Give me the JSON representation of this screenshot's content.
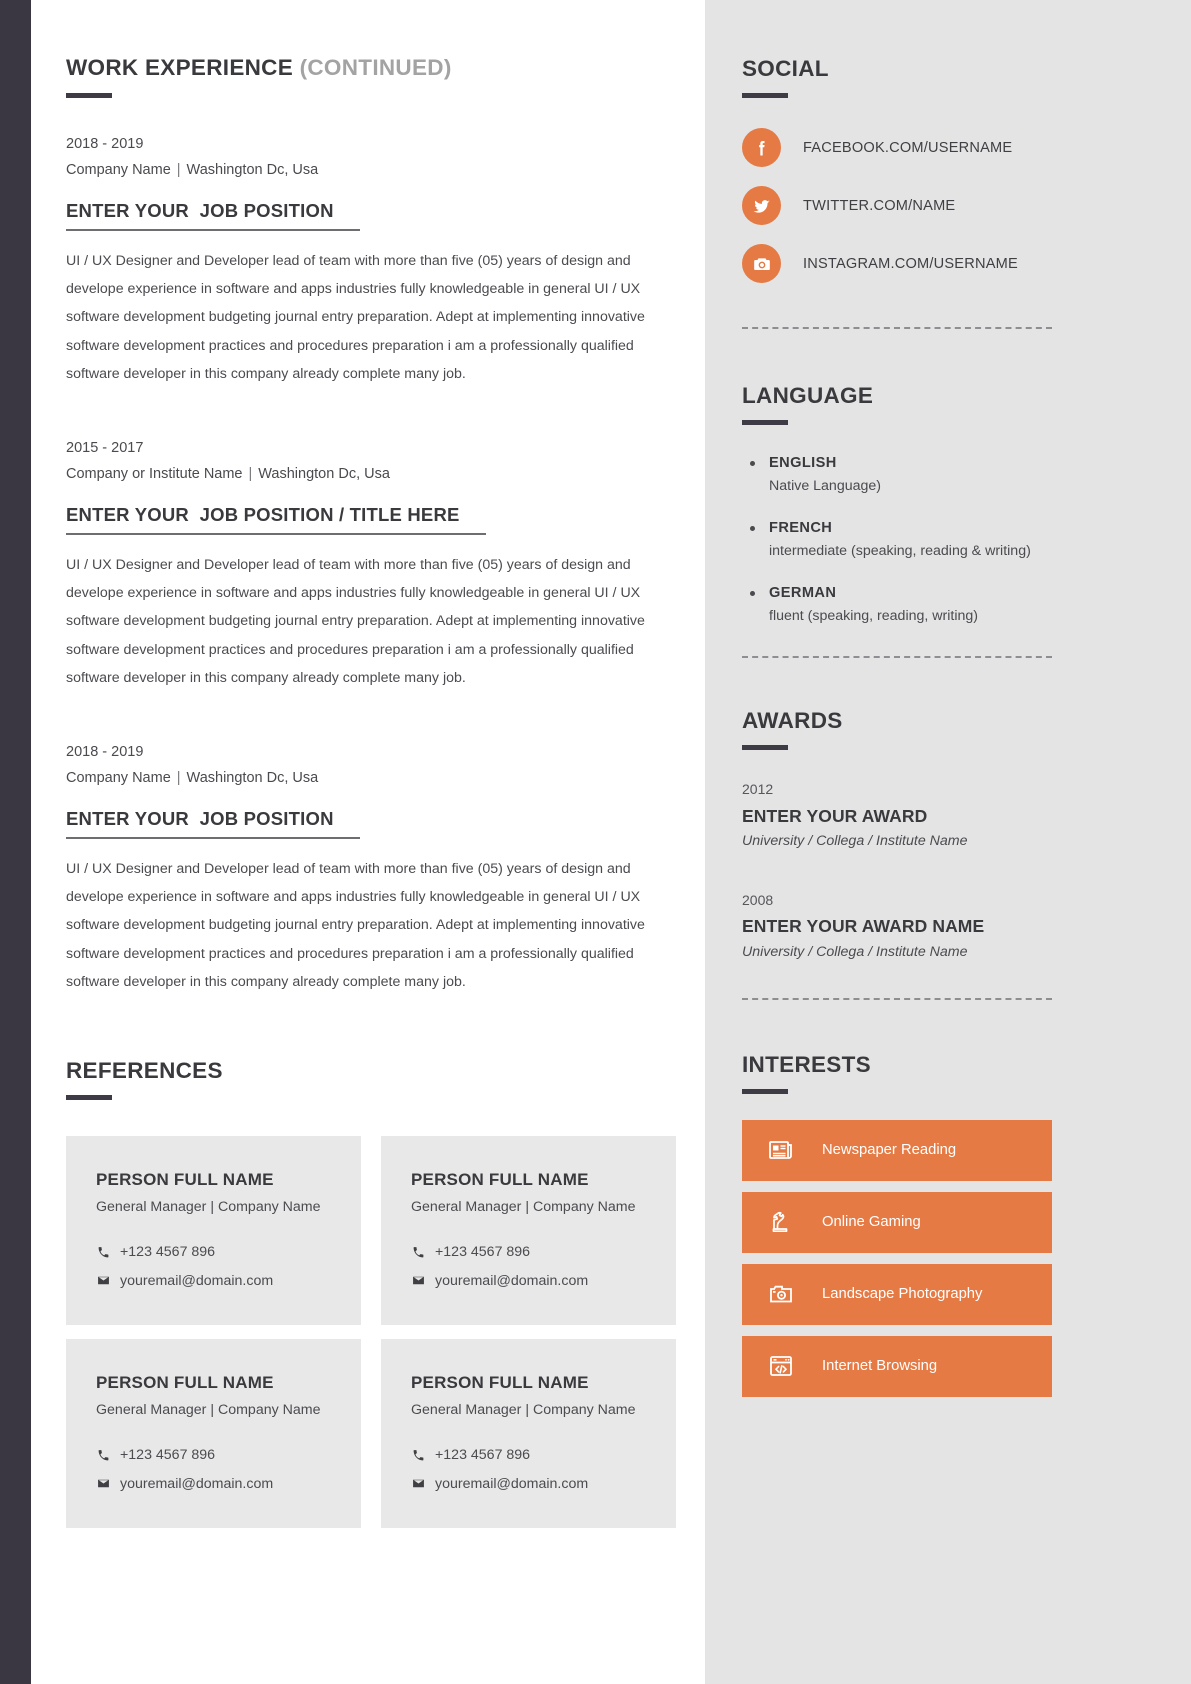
{
  "theme": {
    "accent": "#e57a44",
    "dark": "#3b3742",
    "sidebar_bg": "#e4e4e4",
    "card_bg": "#e8e8e8"
  },
  "main": {
    "section_title": "WORK EXPERIENCE",
    "section_title_suffix": "(CONTINUED)",
    "jobs": [
      {
        "dates": "2018 - 2019",
        "company": "Company Name",
        "location": "Washington Dc, Usa",
        "title_prefix": "ENTER YOUR",
        "title_main": "JOB POSITION",
        "description": "UI / UX Designer and Developer lead of team with more than five (05) years of design and develope experience in software and apps industries fully knowledgeable in general UI / UX software development budgeting journal entry preparation. Adept at implementing innovative software development practices and procedures preparation i am a professionally qualified software developer in this company already complete many job."
      },
      {
        "dates": "2015 - 2017",
        "company": "Company or Institute Name",
        "location": "Washington Dc, Usa",
        "title_prefix": "ENTER YOUR",
        "title_main": "JOB POSITION / TITLE HERE",
        "description": "UI / UX Designer and Developer lead of team with more than five (05) years of design and develope experience in software and apps industries fully knowledgeable in general UI / UX software development budgeting journal entry preparation. Adept at implementing innovative software development practices and procedures preparation i am a professionally qualified software developer in this company already complete many job."
      },
      {
        "dates": "2018 - 2019",
        "company": "Company Name",
        "location": "Washington Dc, Usa",
        "title_prefix": "ENTER YOUR",
        "title_main": "JOB POSITION",
        "description": "UI / UX Designer and Developer lead of team with more than five (05) years of design and develope experience in software and apps industries fully knowledgeable in general UI / UX software development budgeting journal entry preparation. Adept at implementing innovative software development practices and procedures preparation i am a professionally qualified software developer in this company already complete many job."
      }
    ],
    "references_title": "REFERENCES",
    "references": [
      {
        "name": "PERSON FULL NAME",
        "role": "General Manager | Company Name",
        "phone": "+123 4567 896",
        "email": "youremail@domain.com"
      },
      {
        "name": "PERSON FULL NAME",
        "role": "General Manager | Company Name",
        "phone": "+123 4567 896",
        "email": "youremail@domain.com"
      },
      {
        "name": "PERSON FULL NAME",
        "role": "General Manager | Company Name",
        "phone": "+123 4567 896",
        "email": "youremail@domain.com"
      },
      {
        "name": "PERSON FULL NAME",
        "role": "General Manager | Company Name",
        "phone": "+123 4567 896",
        "email": "youremail@domain.com"
      }
    ]
  },
  "sidebar": {
    "social": {
      "title": "SOCIAL",
      "items": [
        {
          "icon": "facebook-icon",
          "text": "FACEBOOK.COM/USERNAME"
        },
        {
          "icon": "twitter-icon",
          "text": "TWITTER.COM/NAME"
        },
        {
          "icon": "instagram-icon",
          "text": "INSTAGRAM.COM/USERNAME"
        }
      ]
    },
    "language": {
      "title": "LANGUAGE",
      "items": [
        {
          "name": "ENGLISH",
          "level": "Native Language)"
        },
        {
          "name": "FRENCH",
          "level": "intermediate (speaking, reading & writing)"
        },
        {
          "name": "GERMAN",
          "level": "fluent (speaking, reading, writing)"
        }
      ]
    },
    "awards": {
      "title": "AWARDS",
      "items": [
        {
          "year": "2012",
          "title": "ENTER YOUR AWARD",
          "org": "University / Collega / Institute Name"
        },
        {
          "year": "2008",
          "title": "ENTER YOUR AWARD NAME",
          "org": "University / Collega / Institute Name"
        }
      ]
    },
    "interests": {
      "title": "INTERESTS",
      "items": [
        {
          "icon": "newspaper-icon",
          "label": "Newspaper Reading"
        },
        {
          "icon": "chess-knight-icon",
          "label": "Online Gaming"
        },
        {
          "icon": "camera-icon",
          "label": "Landscape Photography"
        },
        {
          "icon": "browser-code-icon",
          "label": "Internet Browsing"
        }
      ]
    }
  }
}
